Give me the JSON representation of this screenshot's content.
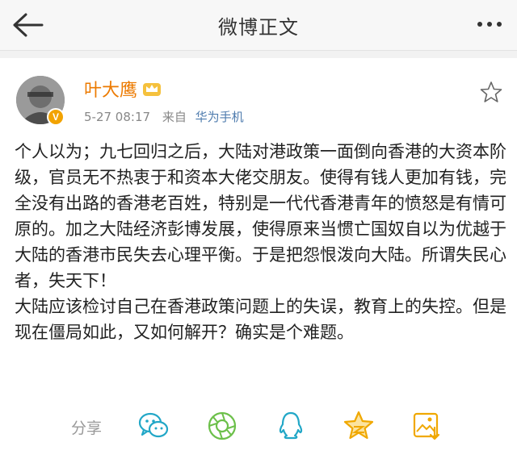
{
  "header": {
    "title": "微博正文",
    "back_icon": "back-arrow-icon",
    "more_icon": "more-dots-icon"
  },
  "post": {
    "author": "叶大鹰",
    "verified_badge": "V",
    "time": "5-27 08:17",
    "from_label": "来自",
    "source": "华为手机",
    "paragraphs": [
      "个人以为；九七回归之后，大陆对港政策一面倒向香港的大资本阶级，官员无不热衷于和资本大佬交朋友。使得有钱人更加有钱，完全没有出路的香港老百姓，特别是一代代香港青年的愤怒是有情可原的。加之大陆经济彭博发展，使得原来当惯亡国奴自以为优越于大陆的香港市民失去心理平衡。于是把怨恨泼向大陆。所谓失民心者，失天下！",
      "大陆应该检讨自己在香港政策问题上的失误，教育上的失控。但是现在僵局如此，又如何解开？确实是个难题。"
    ]
  },
  "share": {
    "label": "分享",
    "icons": [
      "wechat-icon",
      "moments-icon",
      "qq-icon",
      "qzone-icon",
      "save-image-icon"
    ]
  },
  "colors": {
    "accent": "#f2a300",
    "username": "#ec7a00",
    "link": "#4f7cae",
    "share_icon": "#22a7c7"
  }
}
